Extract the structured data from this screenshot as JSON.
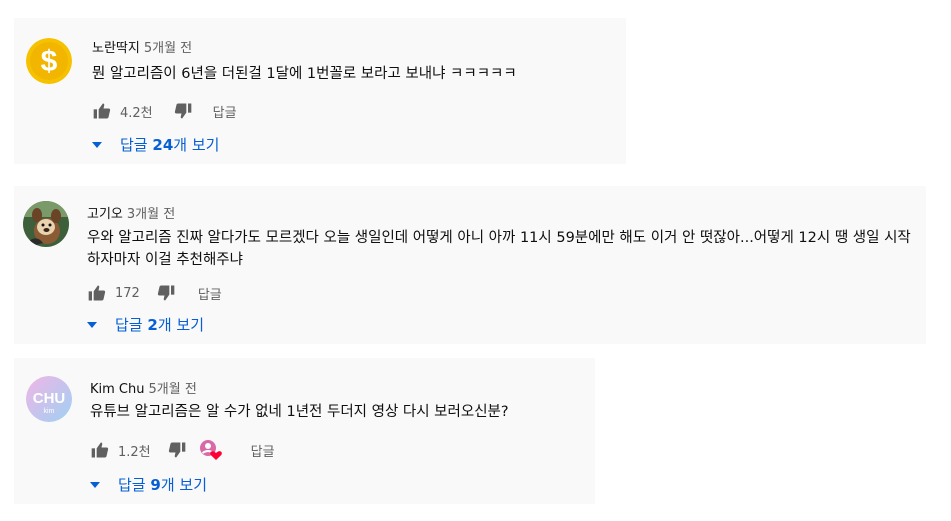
{
  "comments": [
    {
      "author": "노란딱지",
      "time": "5개월 전",
      "text": "뭔 알고리즘이 6년을 더된걸 1달에 1번꼴로 보라고 보내냐 ㅋㅋㅋㅋㅋ",
      "likes": "4.2천",
      "reply_label": "답글",
      "replies_prefix": "답글 ",
      "replies_count": "24",
      "replies_suffix": "개 보기",
      "avatar_icon": "dollar-coin-icon",
      "avatar_color": "#f6c200"
    },
    {
      "author": "고기오",
      "time": "3개월 전",
      "text": "우와 알고리즘 진짜 알다가도 모르겠다 오늘 생일인데 어떻게 아니 아까 11시 59분에만 해도 이거 안 떳잖아...어떻게 12시 땡 생일 시작하자마자 이걸 추천해주냐",
      "likes": "172",
      "reply_label": "답글",
      "replies_prefix": "답글 ",
      "replies_count": "2",
      "replies_suffix": "개 보기",
      "avatar_icon": "cartoon-character-avatar",
      "avatar_color": "#3d5f3a"
    },
    {
      "author": "Kim Chu",
      "time": "5개월 전",
      "text": "유튜브 알고리즘은 알 수가 없네 1년전 두더지 영상 다시 보러오신분?",
      "likes": "1.2천",
      "reply_label": "답글",
      "replies_prefix": "답글 ",
      "replies_count": "9",
      "replies_suffix": "개 보기",
      "avatar_icon": "chu-kim-logo-avatar",
      "avatar_color": "#c6b5ef",
      "avatar_logo_main": "CHU",
      "avatar_logo_sub": "kim",
      "creator_heart": true
    }
  ],
  "colors": {
    "card_bg": "#f9f9f9",
    "text": "#0f0f0f",
    "secondary_text": "#606060",
    "link_blue": "#065fd4",
    "heart_red": "#ff0033"
  }
}
